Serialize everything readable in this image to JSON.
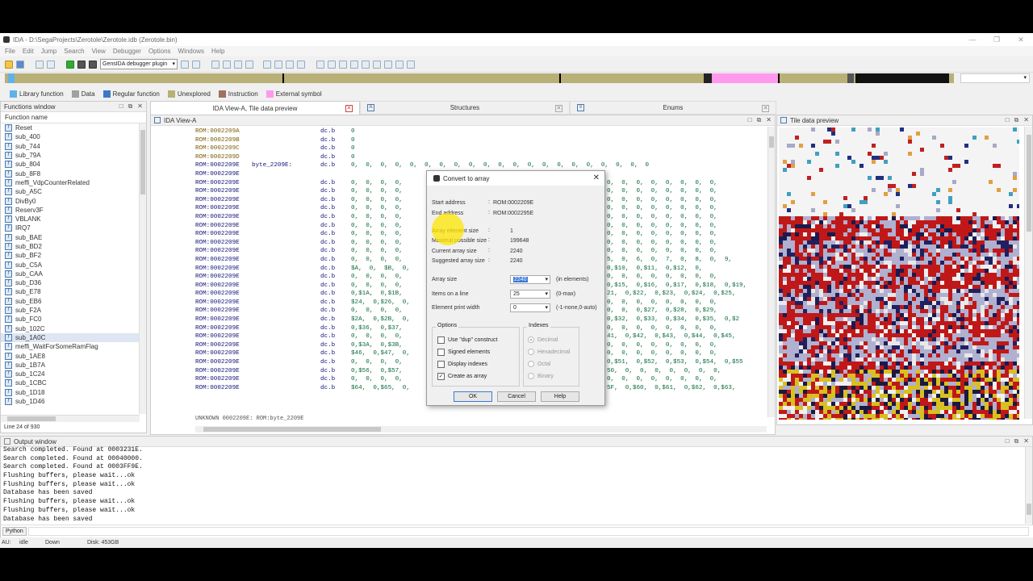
{
  "window": {
    "title": "IDA - D:\\SegaProjects\\Zerotole\\Zerotole.idb (Zerotole.bin)"
  },
  "menu": [
    "File",
    "Edit",
    "Jump",
    "Search",
    "View",
    "Debugger",
    "Options",
    "Windows",
    "Help"
  ],
  "toolbar": {
    "debugger_select": "GensIDA debugger plugin"
  },
  "legend": [
    {
      "label": "Library function",
      "color": "#5fb3e8"
    },
    {
      "label": "Data",
      "color": "#a0a0a0"
    },
    {
      "label": "Regular function",
      "color": "#3c78c8"
    },
    {
      "label": "Unexplored",
      "color": "#b8b077"
    },
    {
      "label": "Instruction",
      "color": "#a07060"
    },
    {
      "label": "External symbol",
      "color": "#ff99ee"
    }
  ],
  "functions": {
    "title": "Functions window",
    "column": "Function name",
    "items": [
      "Reset",
      "sub_400",
      "sub_744",
      "sub_79A",
      "sub_804",
      "sub_8F8",
      "meffi_VdpCounterRelated",
      "sub_A5C",
      "DivBy0",
      "Reserv3F",
      "VBLANK",
      "IRQ7",
      "sub_BAE",
      "sub_BD2",
      "sub_BF2",
      "sub_C5A",
      "sub_CAA",
      "sub_D36",
      "sub_E78",
      "sub_EB6",
      "sub_F2A",
      "sub_FC0",
      "sub_102C",
      "sub_1A0C",
      "meffi_WaitForSomeRamFlag",
      "sub_1AE8",
      "sub_1B7A",
      "sub_1C24",
      "sub_1CBC",
      "sub_1D18",
      "sub_1D46"
    ],
    "selected_index": 23,
    "line_status": "Line 24 of 930"
  },
  "tabs": [
    {
      "label": "IDA View-A, Tile data preview"
    },
    {
      "label": "Structures"
    },
    {
      "label": "Enums"
    }
  ],
  "ida_view": {
    "title": "IDA View-A",
    "lines": [
      {
        "addr": "ROM:0002209A",
        "lbl": "",
        "ins": "dc.b",
        "ops": "0"
      },
      {
        "addr": "ROM:0002209B",
        "lbl": "",
        "ins": "dc.b",
        "ops": "0"
      },
      {
        "addr": "ROM:0002209C",
        "lbl": "",
        "ins": "dc.b",
        "ops": "0"
      },
      {
        "addr": "ROM:0002209D",
        "lbl": "",
        "ins": "dc.b",
        "ops": "0"
      },
      {
        "addr": "ROM:0002209E",
        "lbl": "byte_2209E:",
        "ins": "dc.b",
        "ops": "0,  0,  0,  0,  0,  0,  0,  0,  0,  0,  0,  0,  0,  0,  0,  0,  0,  0,  0,  0,  0"
      },
      {
        "addr": "ROM:0002209E",
        "lbl": "",
        "ins": "",
        "ops": ""
      },
      {
        "addr": "ROM:0002209E",
        "lbl": "",
        "ins": "dc.b",
        "ops": "0,  0,  0,  0,"
      },
      {
        "addr": "ROM:0002209E",
        "lbl": "",
        "ins": "dc.b",
        "ops": "0,  0,  0,  0,"
      },
      {
        "addr": "ROM:0002209E",
        "lbl": "",
        "ins": "dc.b",
        "ops": "0,  0,  0,  0,"
      },
      {
        "addr": "ROM:0002209E",
        "lbl": "",
        "ins": "dc.b",
        "ops": "0,  0,  0,  0,"
      },
      {
        "addr": "ROM:0002209E",
        "lbl": "",
        "ins": "dc.b",
        "ops": "0,  0,  0,  0,"
      },
      {
        "addr": "ROM:0002209E",
        "lbl": "",
        "ins": "dc.b",
        "ops": "0,  0,  0,  0,"
      },
      {
        "addr": "ROM:0002209E",
        "lbl": "",
        "ins": "dc.b",
        "ops": "0,  0,  0,  0,"
      },
      {
        "addr": "ROM:0002209E",
        "lbl": "",
        "ins": "dc.b",
        "ops": "0,  0,  0,  0,"
      },
      {
        "addr": "ROM:0002209E",
        "lbl": "",
        "ins": "dc.b",
        "ops": "0,  0,  0,  0,"
      },
      {
        "addr": "ROM:0002209E",
        "lbl": "",
        "ins": "dc.b",
        "ops": "0,  0,  0,  0,"
      },
      {
        "addr": "ROM:0002209E",
        "lbl": "",
        "ins": "dc.b",
        "ops": "$A,  0,  $B,  0,"
      },
      {
        "addr": "ROM:0002209E",
        "lbl": "",
        "ins": "dc.b",
        "ops": "0,  0,  0,  0,"
      },
      {
        "addr": "ROM:0002209E",
        "lbl": "",
        "ins": "dc.b",
        "ops": "0,  0,  0,  0,"
      },
      {
        "addr": "ROM:0002209E",
        "lbl": "",
        "ins": "dc.b",
        "ops": "0,$1A,  0,$1B,"
      },
      {
        "addr": "ROM:0002209E",
        "lbl": "",
        "ins": "dc.b",
        "ops": "$24,  0,$26,  0,"
      },
      {
        "addr": "ROM:0002209E",
        "lbl": "",
        "ins": "dc.b",
        "ops": "0,  0,  0,  0,"
      },
      {
        "addr": "ROM:0002209E",
        "lbl": "",
        "ins": "dc.b",
        "ops": "$2A,  0,$2B,  0,"
      },
      {
        "addr": "ROM:0002209E",
        "lbl": "",
        "ins": "dc.b",
        "ops": "0,$36,  0,$37,"
      },
      {
        "addr": "ROM:0002209E",
        "lbl": "",
        "ins": "dc.b",
        "ops": "0,  0,  0,  0,"
      },
      {
        "addr": "ROM:0002209E",
        "lbl": "",
        "ins": "dc.b",
        "ops": "0,$3A,  0,$3B,"
      },
      {
        "addr": "ROM:0002209E",
        "lbl": "",
        "ins": "dc.b",
        "ops": "$46,  0,$47,  0,"
      },
      {
        "addr": "ROM:0002209E",
        "lbl": "",
        "ins": "dc.b",
        "ops": "0,  0,  0,  0,"
      },
      {
        "addr": "ROM:0002209E",
        "lbl": "",
        "ins": "dc.b",
        "ops": "0,$56,  0,$57,"
      },
      {
        "addr": "ROM:0002209E",
        "lbl": "",
        "ins": "dc.b",
        "ops": "0,  0,  0,  0,"
      },
      {
        "addr": "ROM:0002209E",
        "lbl": "",
        "ins": "dc.b",
        "ops": "$64,  0,$65,  0,"
      }
    ],
    "right_cols": [
      "",
      "",
      "",
      "",
      "",
      "",
      "0,  0,  0,  0,  0,  0,  0,  0,",
      "0,  0,  0,  0,  0,  0,  0,  0,",
      "0,  0,  0,  0,  0,  0,  0,  0,",
      "0,  0,  0,  0,  0,  0,  0,  0,",
      "0,  0,  0,  0,  0,  0,  0,  0,",
      "0,  0,  0,  0,  0,  0,  0,  0,",
      "0,  0,  0,  0,  0,  0,  0,  0,",
      "0,  0,  0,  0,  0,  0,  0,  0,",
      "0,  0,  0,  0,  0,  0,  0,  0,",
      "5,  0,  6,  0,  7,  0,  8,  0,  9,",
      "0,$10,  0,$11,  0,$12,  0,",
      "0,  0,  0,  0,  0,  0,  0,  0,",
      "0,$15,  0,$16,  0,$17,  0,$18,  0,$19,",
      "21,  0,$22,  0,$23,  0,$24,  0,$25,",
      "0,  0,  0,  0,  0,  0,  0,  0,",
      "0,  0,  0,$27,  0,$28,  0,$29,",
      "0,$32,  0,$33,  0,$34,  0,$35,  0,$2",
      "0,  0,  0,  0,  0,  0,  0,  0,",
      "41,  0,$42,  0,$43,  0,$44,  0,$45,",
      "0,  0,  0,  0,  0,  0,  0,  0,",
      "0,  0,  0,  0,  0,  0,  0,  0,",
      "0,$51,  0,$52,  0,$53,  0,$54,  0,$55",
      "50,  0,  0,  0,  0,  0,  0,  0,",
      "0,  0,  0,  0,  0,  0,  0,  0,",
      "5F,  0,$60,  0,$61,  0,$62,  0,$63,"
    ],
    "bottom_line": "UNKNOWN 0002209E: ROM:byte_2209E"
  },
  "tile_preview": {
    "title": "Tile data preview"
  },
  "dialog": {
    "title": "Convert to array",
    "start_address_label": "Start address",
    "start_address": "ROM:0002209E",
    "end_address_label": "End address",
    "end_address": "ROM:0002295E",
    "elem_size_label": "Array element size",
    "elem_size": "1",
    "max_size_label": "Maximal possible size",
    "max_size": "199648",
    "cur_size_label": "Current array size",
    "cur_size": "2240",
    "sugg_size_label": "Suggested array size",
    "sugg_size": "2240",
    "array_size_label": "Array size",
    "array_size": "2240",
    "array_size_hint": "(in elements)",
    "items_label": "Items on a line",
    "items": "25",
    "items_hint": "(0-max)",
    "width_label": "Element print width",
    "width": "0",
    "width_hint": "(-1-none,0-auto)",
    "options_title": "Options",
    "options": [
      {
        "label": "Use \"dup\" construct",
        "checked": false
      },
      {
        "label": "Signed elements",
        "checked": false
      },
      {
        "label": "Display indexes",
        "checked": false
      },
      {
        "label": "Create as array",
        "checked": true
      }
    ],
    "indexes_title": "Indexes",
    "indexes": [
      {
        "label": "Decimal",
        "selected": true
      },
      {
        "label": "Hexadecimal",
        "selected": false
      },
      {
        "label": "Octal",
        "selected": false
      },
      {
        "label": "Binary",
        "selected": false
      }
    ],
    "ok": "OK",
    "cancel": "Cancel",
    "help": "Help"
  },
  "output": {
    "title": "Output window",
    "lines": [
      "Search completed. Found at 0003231E.",
      "Search completed. Found at 00040000.",
      "Search completed. Found at 0003FF9E.",
      "Flushing buffers, please wait...ok",
      "Flushing buffers, please wait...ok",
      "Database has been saved",
      "Flushing buffers, please wait...ok",
      "Flushing buffers, please wait...ok",
      "Database has been saved"
    ],
    "lang": "Python"
  },
  "status": {
    "au": "AU:",
    "state": "idle",
    "dir": "Down",
    "disk": "Disk: 453GB"
  }
}
